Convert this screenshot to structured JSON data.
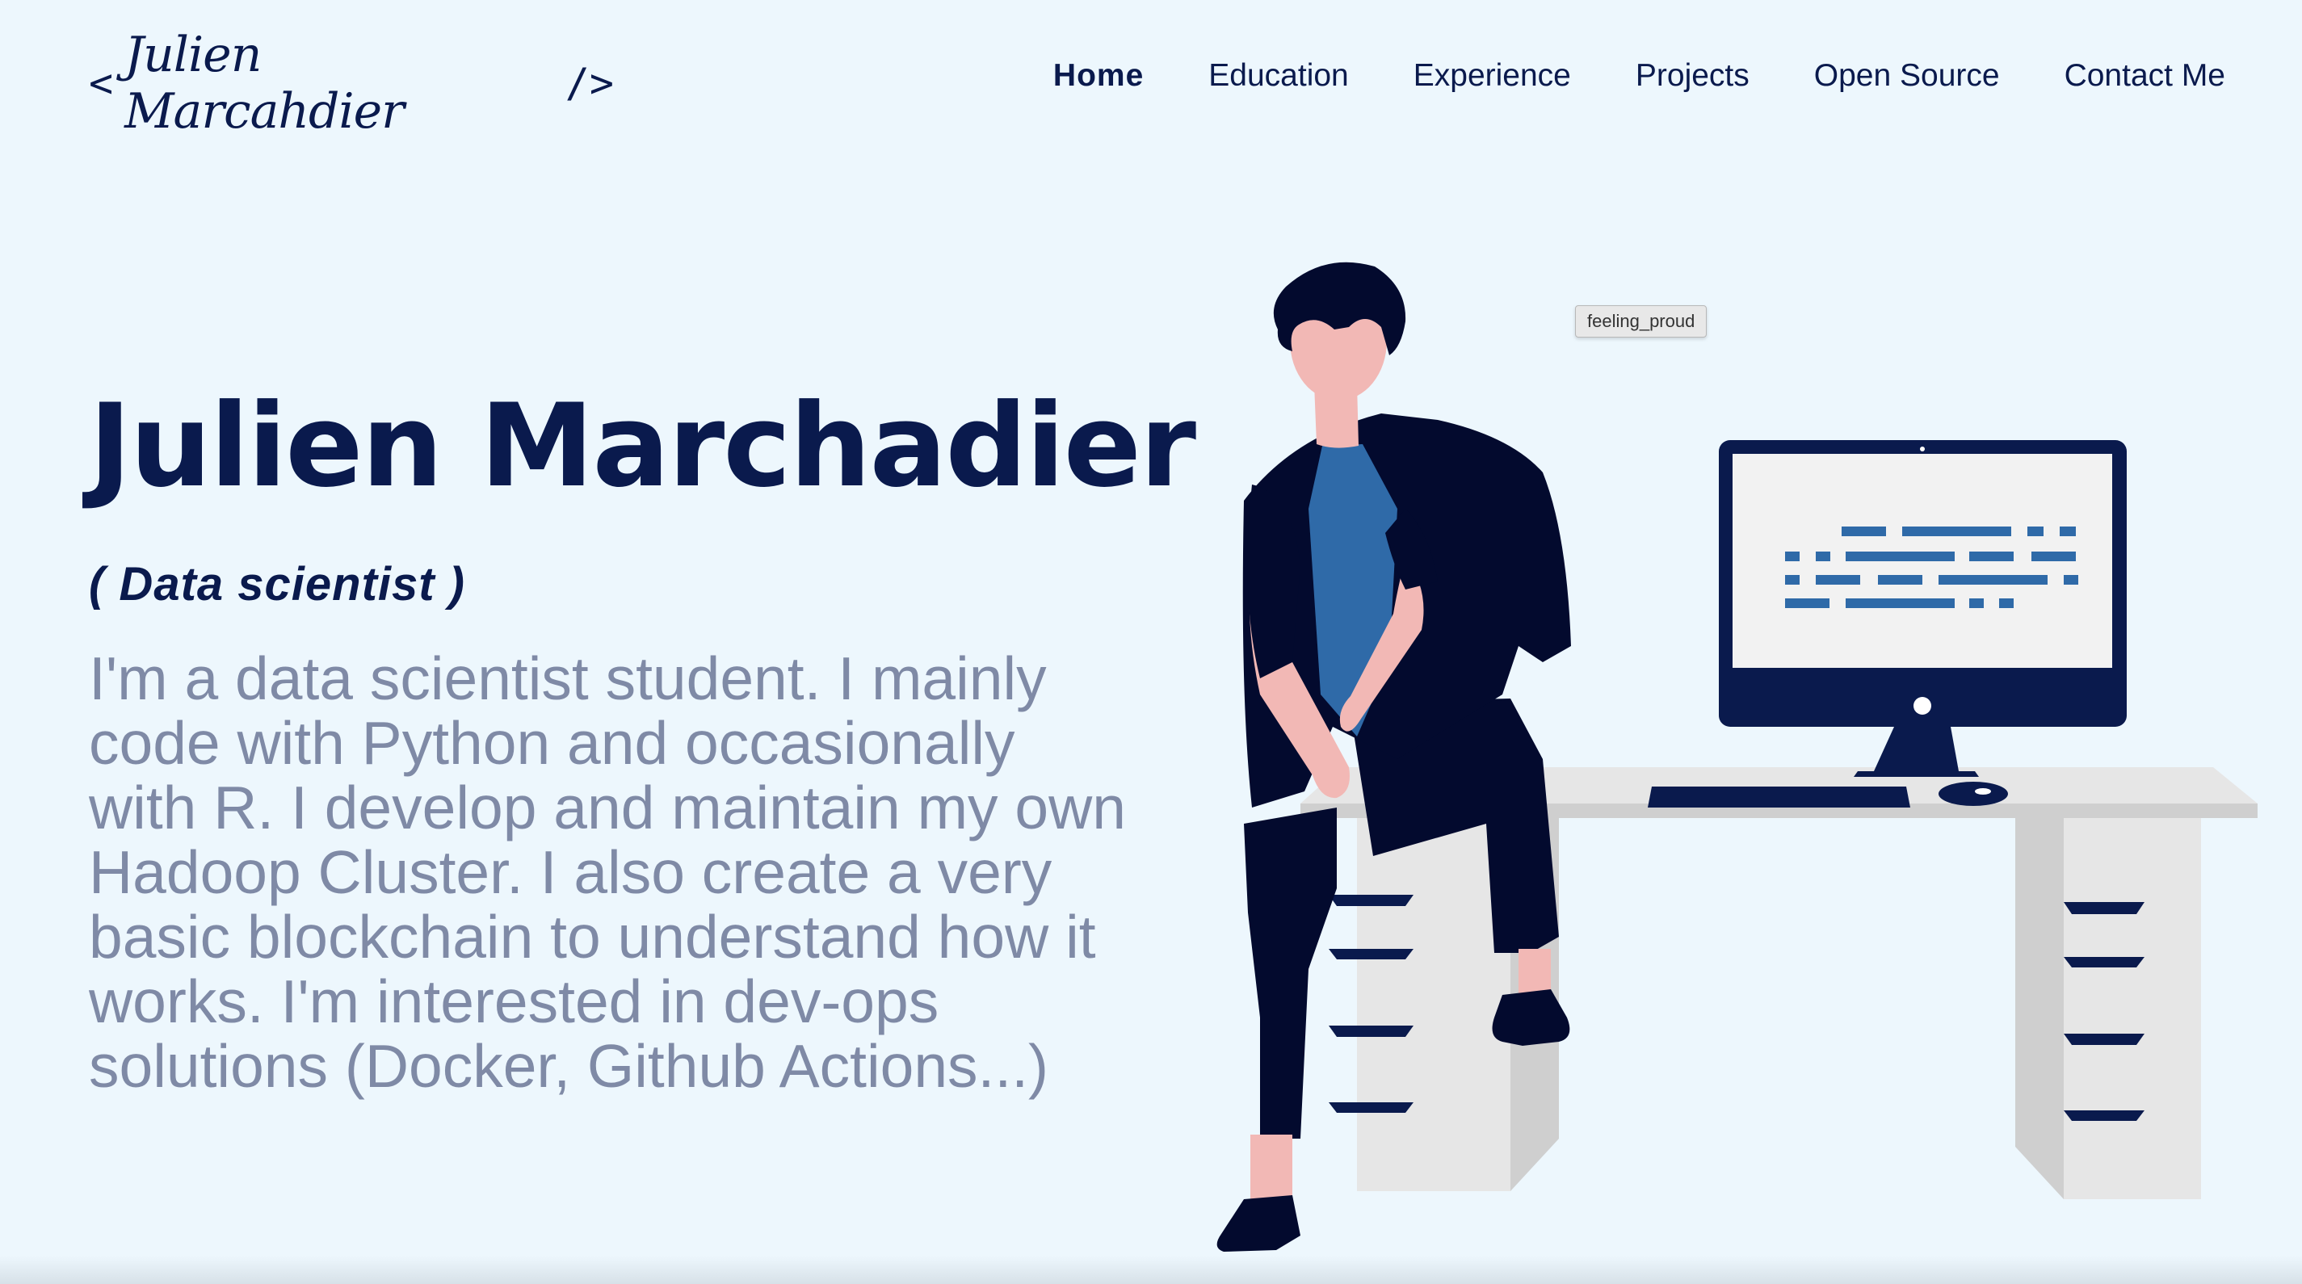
{
  "header": {
    "logo": {
      "open_bracket": "<",
      "signature": "Julien Marcahdier",
      "close_bracket": "/>"
    },
    "nav": [
      {
        "label": "Home",
        "active": true
      },
      {
        "label": "Education",
        "active": false
      },
      {
        "label": "Experience",
        "active": false
      },
      {
        "label": "Projects",
        "active": false
      },
      {
        "label": "Open Source",
        "active": false
      },
      {
        "label": "Contact Me",
        "active": false
      }
    ]
  },
  "hero": {
    "name": "Julien Marchadier",
    "role": "( Data scientist )",
    "bio": "I'm a data scientist student. I mainly code with Python and occasionally with R. I develop and maintain my own Hadoop Cluster. I also create a very basic blockchain to understand how it works. I'm interested in dev-ops solutions (Docker, Github Actions...)"
  },
  "illustration": {
    "tooltip": "feeling_proud"
  },
  "colors": {
    "background": "#edf7fd",
    "primary": "#0a1a4d",
    "body_text": "#7f8aa6",
    "accent_blue": "#2f6aa8",
    "skin": "#f2b8b5",
    "desk": "#e6e6e6",
    "desk_shadow": "#cfcfcf"
  }
}
